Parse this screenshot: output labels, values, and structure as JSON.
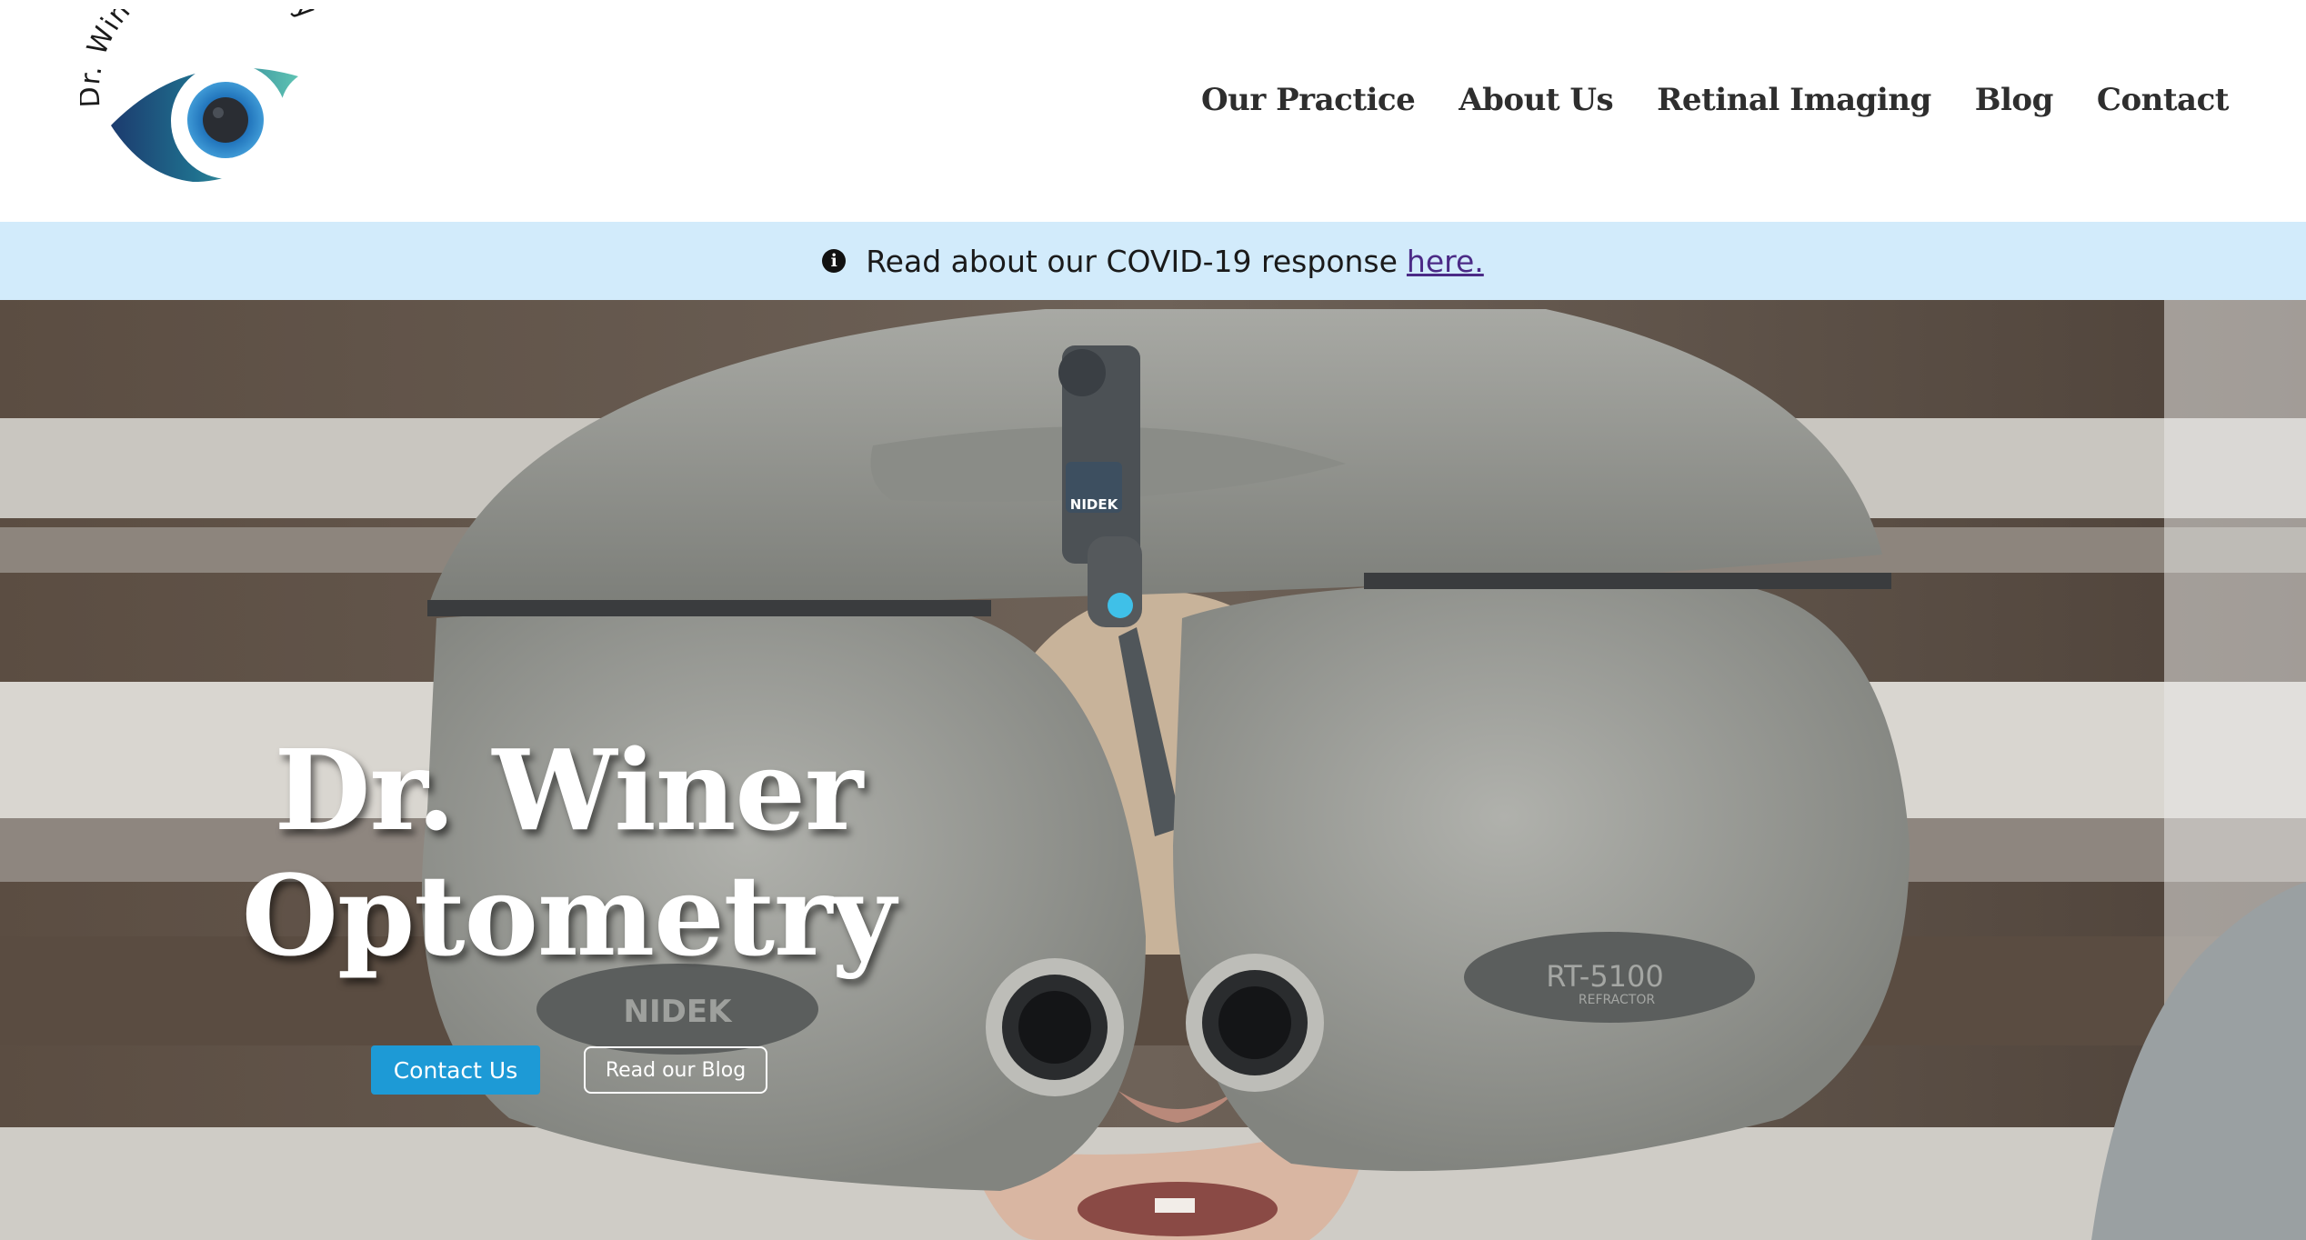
{
  "logo": {
    "text": "Dr. Winer Optometry",
    "icon": "eye-logo-icon"
  },
  "nav": {
    "items": [
      {
        "label": "Our Practice"
      },
      {
        "label": "About Us"
      },
      {
        "label": "Retinal Imaging"
      },
      {
        "label": "Blog"
      },
      {
        "label": "Contact"
      }
    ]
  },
  "banner": {
    "icon": "info-icon",
    "icon_glyph": "i",
    "text": "Read about our COVID-19 response",
    "link_text": "here."
  },
  "hero": {
    "title_line1": "Dr. Winer",
    "title_line2": "Optometry",
    "primary_button": "Contact Us",
    "secondary_button": "Read our Blog",
    "device_brand": "NIDEK",
    "device_model": "RT-5100",
    "device_type": "REFRACTOR"
  },
  "colors": {
    "banner_bg": "#d2ebfb",
    "primary_button": "#1d9ad6",
    "nav_text": "#2e2e2e",
    "link": "#4b2a86"
  }
}
